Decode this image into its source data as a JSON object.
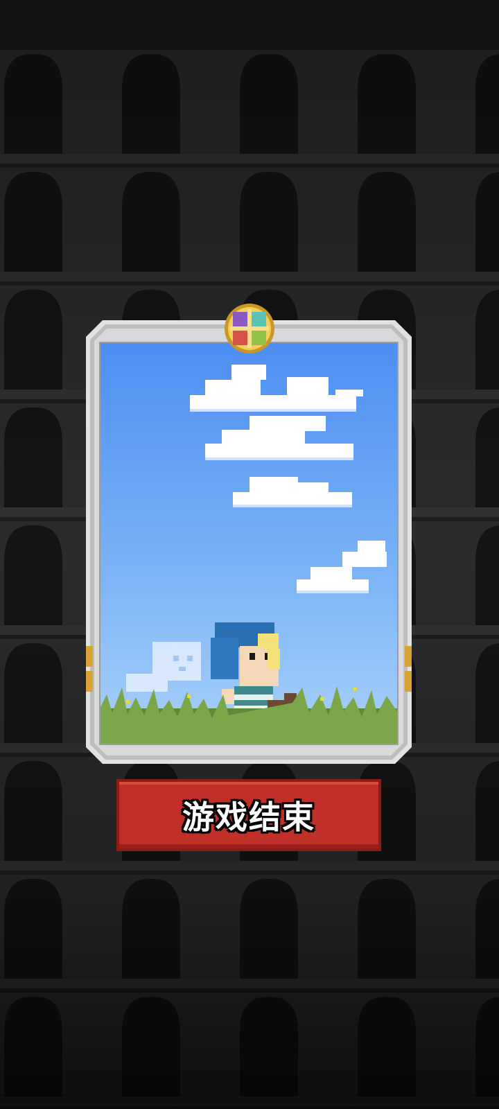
{
  "screen": "game-over",
  "card": {
    "scene": "hero-in-meadow",
    "emblem_icon": "four-class-emblem-icon",
    "sky_color_top": "#4c8ef2",
    "sky_color_bottom": "#a9d1fb",
    "frame_color": "#cfd0d1"
  },
  "button": {
    "label": "游戏结束",
    "color": "#c03028"
  },
  "background": {
    "theme": "dark-stone-arcades",
    "color": "#151617"
  }
}
